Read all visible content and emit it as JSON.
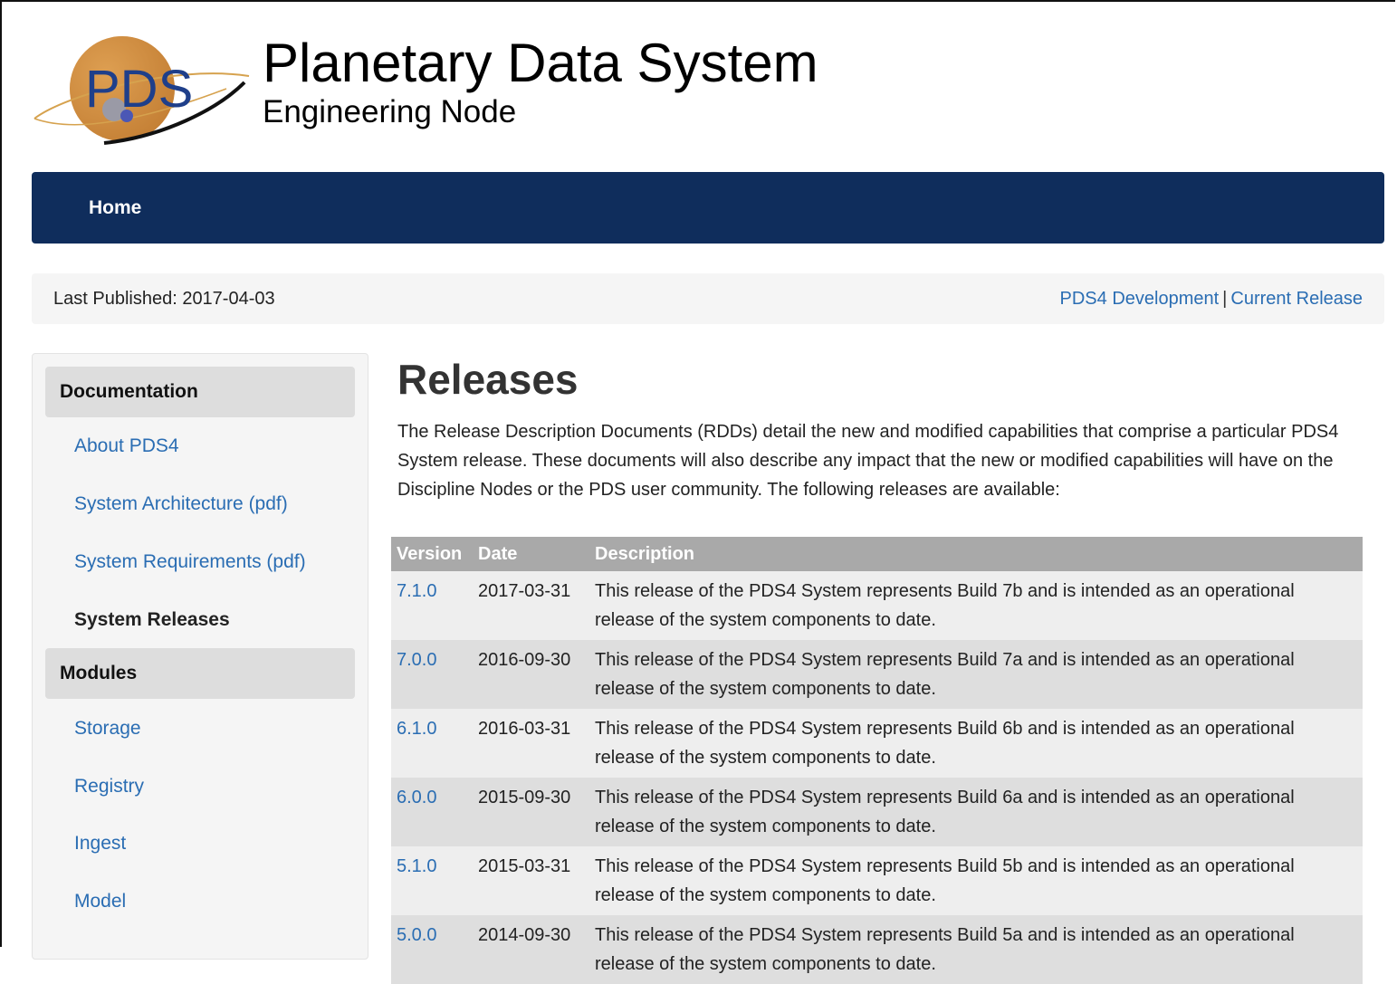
{
  "header": {
    "logo_text": "PDS",
    "title": "Planetary Data System",
    "subtitle": "Engineering Node"
  },
  "navbar": {
    "home_label": "Home"
  },
  "publish_bar": {
    "last_published": "Last Published: 2017-04-03",
    "link_dev": "PDS4 Development",
    "separator": "|",
    "link_current": "Current Release"
  },
  "sidebar": {
    "documentation_header": "Documentation",
    "doc_items": [
      {
        "label": "About PDS4"
      },
      {
        "label": "System Architecture (pdf)"
      },
      {
        "label": "System Requirements (pdf)"
      },
      {
        "label": "System Releases"
      }
    ],
    "modules_header": "Modules",
    "module_items": [
      {
        "label": "Storage"
      },
      {
        "label": "Registry"
      },
      {
        "label": "Ingest"
      },
      {
        "label": "Model"
      }
    ]
  },
  "main": {
    "title": "Releases",
    "intro": "The Release Description Documents (RDDs) detail the new and modified capabilities that comprise a particular PDS4 System release. These documents will also describe any impact that the new or modified capabilities will have on the Discipline Nodes or the PDS user community. The following releases are available:",
    "table": {
      "headers": [
        "Version",
        "Date",
        "Description"
      ],
      "rows": [
        {
          "version": "7.1.0",
          "date": "2017-03-31",
          "description": "This release of the PDS4 System represents Build 7b and is intended as an operational release of the system components to date."
        },
        {
          "version": "7.0.0",
          "date": "2016-09-30",
          "description": "This release of the PDS4 System represents Build 7a and is intended as an operational release of the system components to date."
        },
        {
          "version": "6.1.0",
          "date": "2016-03-31",
          "description": "This release of the PDS4 System represents Build 6b and is intended as an operational release of the system components to date."
        },
        {
          "version": "6.0.0",
          "date": "2015-09-30",
          "description": "This release of the PDS4 System represents Build 6a and is intended as an operational release of the system components to date."
        },
        {
          "version": "5.1.0",
          "date": "2015-03-31",
          "description": "This release of the PDS4 System represents Build 5b and is intended as an operational release of the system components to date."
        },
        {
          "version": "5.0.0",
          "date": "2014-09-30",
          "description": "This release of the PDS4 System represents Build 5a and is intended as an operational release of the system components to date."
        }
      ]
    }
  },
  "colors": {
    "navbar": "#0f2d5c",
    "link": "#2a6db3",
    "table_header": "#a9a9a9",
    "logo_orange": "#d6903a",
    "logo_blue": "#1f3f8a"
  }
}
